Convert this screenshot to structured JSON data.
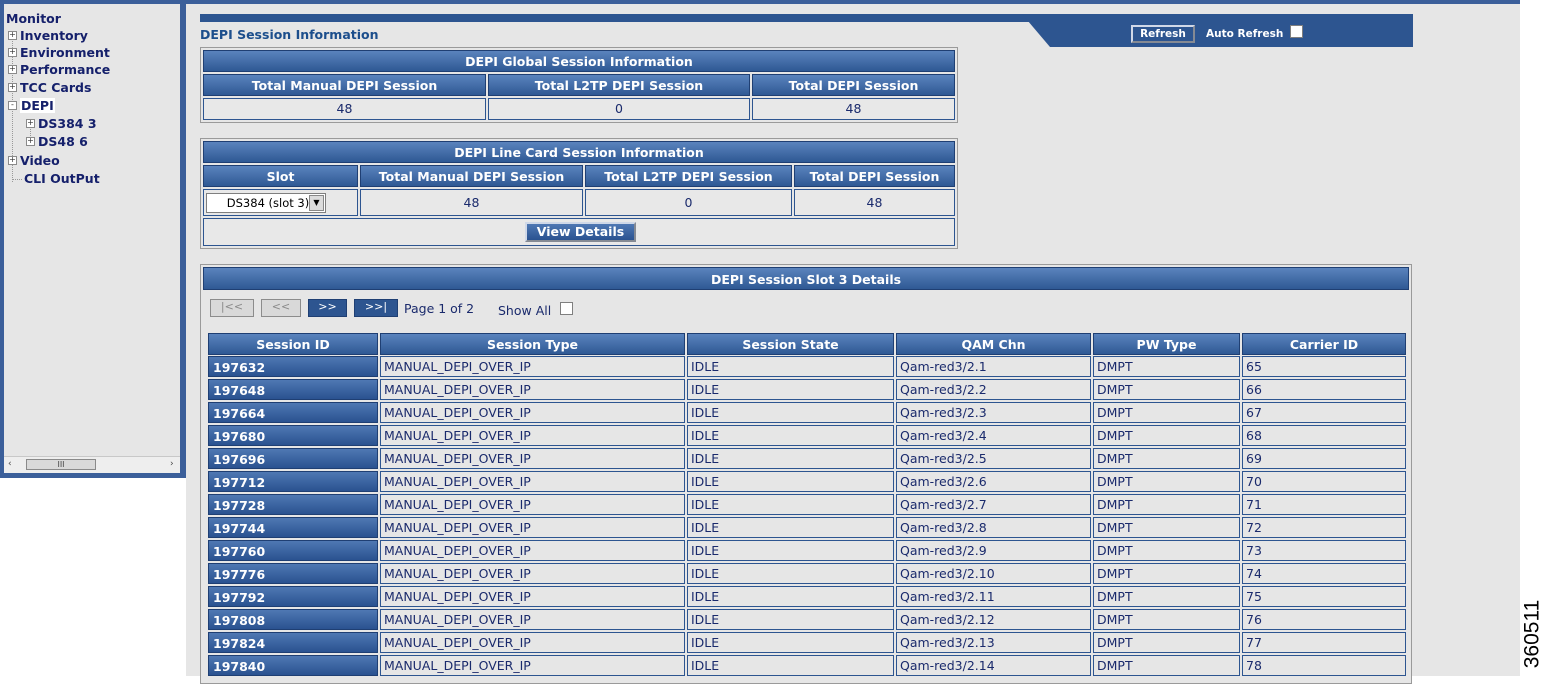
{
  "tree": {
    "root": "Monitor",
    "items": [
      {
        "label": "Inventory",
        "expander": "+"
      },
      {
        "label": "Environment",
        "expander": "+"
      },
      {
        "label": "Performance",
        "expander": "+"
      },
      {
        "label": "TCC Cards",
        "expander": "+"
      },
      {
        "label": "DEPI",
        "expander": "-"
      },
      {
        "label": "DS384 3",
        "expander": "+"
      },
      {
        "label": "DS48 6",
        "expander": "+"
      },
      {
        "label": "Video",
        "expander": "+"
      },
      {
        "label": "CLI OutPut",
        "expander": ""
      }
    ],
    "scroll_left": "‹",
    "scroll_right": "›",
    "scroll_thumb": "III"
  },
  "header": {
    "title": "DEPI Session Information",
    "refresh_label": "Refresh",
    "auto_refresh_label": "Auto Refresh",
    "auto_refresh_checked": false
  },
  "global": {
    "title": "DEPI Global Session Information",
    "columns": [
      "Total Manual DEPI Session",
      "Total L2TP DEPI Session",
      "Total DEPI Session"
    ],
    "values": [
      "48",
      "0",
      "48"
    ]
  },
  "linecard": {
    "title": "DEPI Line Card Session Information",
    "columns": [
      "Slot",
      "Total Manual DEPI Session",
      "Total L2TP DEPI Session",
      "Total DEPI Session"
    ],
    "slot_selected": "DS384 (slot 3)",
    "values": [
      "48",
      "0",
      "48"
    ],
    "view_details_label": "View Details"
  },
  "details": {
    "title": "DEPI Session Slot 3 Details",
    "pager": {
      "first": "|<<",
      "prev": "<<",
      "next": ">>",
      "last": ">>|",
      "page_text": "Page 1 of 2",
      "show_all_label": "Show All",
      "show_all_checked": false
    },
    "columns": [
      "Session ID",
      "Session Type",
      "Session State",
      "QAM Chn",
      "PW Type",
      "Carrier ID"
    ],
    "rows": [
      [
        "197632",
        "MANUAL_DEPI_OVER_IP",
        "IDLE",
        "Qam-red3/2.1",
        "DMPT",
        "65"
      ],
      [
        "197648",
        "MANUAL_DEPI_OVER_IP",
        "IDLE",
        "Qam-red3/2.2",
        "DMPT",
        "66"
      ],
      [
        "197664",
        "MANUAL_DEPI_OVER_IP",
        "IDLE",
        "Qam-red3/2.3",
        "DMPT",
        "67"
      ],
      [
        "197680",
        "MANUAL_DEPI_OVER_IP",
        "IDLE",
        "Qam-red3/2.4",
        "DMPT",
        "68"
      ],
      [
        "197696",
        "MANUAL_DEPI_OVER_IP",
        "IDLE",
        "Qam-red3/2.5",
        "DMPT",
        "69"
      ],
      [
        "197712",
        "MANUAL_DEPI_OVER_IP",
        "IDLE",
        "Qam-red3/2.6",
        "DMPT",
        "70"
      ],
      [
        "197728",
        "MANUAL_DEPI_OVER_IP",
        "IDLE",
        "Qam-red3/2.7",
        "DMPT",
        "71"
      ],
      [
        "197744",
        "MANUAL_DEPI_OVER_IP",
        "IDLE",
        "Qam-red3/2.8",
        "DMPT",
        "72"
      ],
      [
        "197760",
        "MANUAL_DEPI_OVER_IP",
        "IDLE",
        "Qam-red3/2.9",
        "DMPT",
        "73"
      ],
      [
        "197776",
        "MANUAL_DEPI_OVER_IP",
        "IDLE",
        "Qam-red3/2.10",
        "DMPT",
        "74"
      ],
      [
        "197792",
        "MANUAL_DEPI_OVER_IP",
        "IDLE",
        "Qam-red3/2.11",
        "DMPT",
        "75"
      ],
      [
        "197808",
        "MANUAL_DEPI_OVER_IP",
        "IDLE",
        "Qam-red3/2.12",
        "DMPT",
        "76"
      ],
      [
        "197824",
        "MANUAL_DEPI_OVER_IP",
        "IDLE",
        "Qam-red3/2.13",
        "DMPT",
        "77"
      ],
      [
        "197840",
        "MANUAL_DEPI_OVER_IP",
        "IDLE",
        "Qam-red3/2.14",
        "DMPT",
        "78"
      ]
    ]
  },
  "figure_id": "360511",
  "colors": {
    "accent": "#2d5590",
    "panel_bg": "#e6e6e6",
    "text": "#1a2a6c"
  }
}
